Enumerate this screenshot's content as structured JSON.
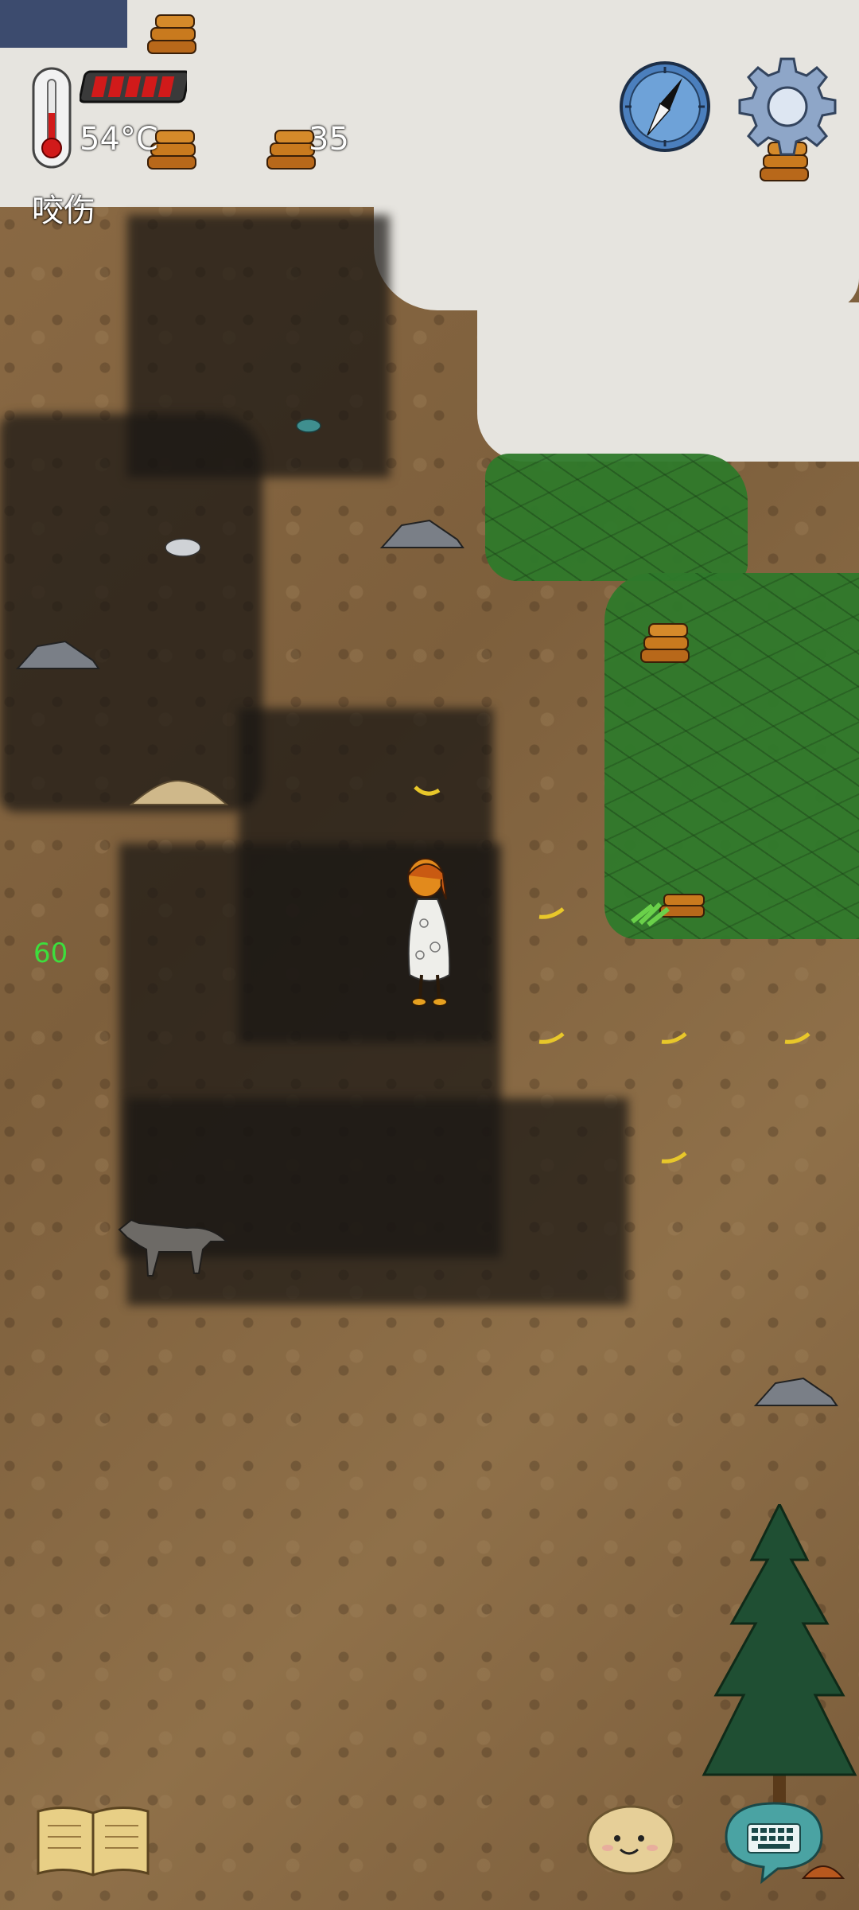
{
  "hud": {
    "temperature": "54°C",
    "health_segments_filled": 5,
    "health_segments_total": 5,
    "wood_count": "35",
    "status_effect": "咬伤",
    "floating_number": "60"
  },
  "icons": {
    "thermometer": "thermometer-icon",
    "health_bar": "health-bar",
    "compass": "compass-icon",
    "settings": "gear-icon",
    "recipe_book": "open-book-icon",
    "emote": "smiley-face-icon",
    "chat": "keyboard-chat-icon"
  },
  "colors": {
    "health_red": "#d11a1a",
    "grass_green": "#2f7a2b",
    "ground_brown": "#8a6a45",
    "fog": "#1e1a17",
    "floating_number_green": "#3dde3d"
  }
}
